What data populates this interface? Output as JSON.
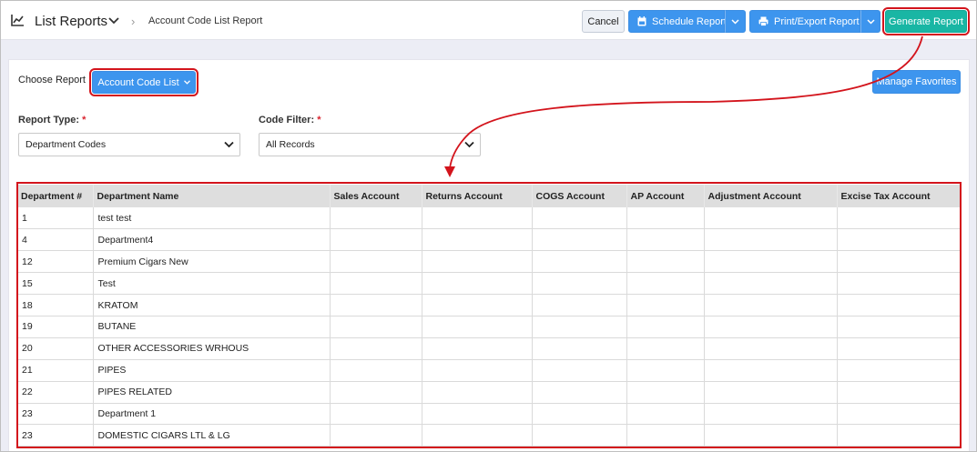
{
  "header": {
    "title": "List Reports",
    "breadcrumb": "Account Code List Report",
    "cancel_label": "Cancel",
    "schedule_label": "Schedule Report",
    "print_label": "Print/Export Report",
    "generate_label": "Generate Report"
  },
  "controls": {
    "choose_report_label": "Choose Report",
    "report_button_label": "Account Code List",
    "manage_favorites_label": "Manage Favorites",
    "report_type_label": "Report Type:",
    "report_type_value": "Department Codes",
    "code_filter_label": "Code Filter:",
    "code_filter_value": "All Records",
    "required_mark": "*"
  },
  "table": {
    "columns": [
      "Department #",
      "Department Name",
      "Sales Account",
      "Returns Account",
      "COGS Account",
      "AP Account",
      "Adjustment Account",
      "Excise Tax Account"
    ],
    "rows": [
      {
        "num": "1",
        "name": "test test"
      },
      {
        "num": "4",
        "name": "Department4"
      },
      {
        "num": "12",
        "name": "Premium Cigars New"
      },
      {
        "num": "15",
        "name": "Test"
      },
      {
        "num": "18",
        "name": "KRATOM"
      },
      {
        "num": "19",
        "name": "BUTANE"
      },
      {
        "num": "20",
        "name": "OTHER ACCESSORIES WRHOUS"
      },
      {
        "num": "21",
        "name": "PIPES"
      },
      {
        "num": "22",
        "name": "PIPES RELATED"
      },
      {
        "num": "23",
        "name": "Department 1"
      },
      {
        "num": "23",
        "name": "DOMESTIC CIGARS LTL & LG"
      }
    ]
  },
  "icons": {
    "title": "line-chart-icon",
    "title_dropdown": "chevron-down-icon",
    "schedule": "calendar-icon",
    "print": "printer-icon"
  },
  "colors": {
    "primary_blue": "#3d95ee",
    "generate_teal": "#19b6a4",
    "highlight_red": "#d3141c",
    "table_header_bg": "#dedede"
  }
}
